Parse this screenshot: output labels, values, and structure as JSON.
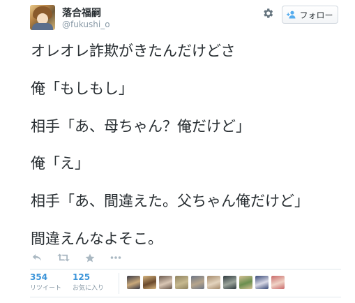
{
  "profile": {
    "display_name": "落合福嗣",
    "screen_name": "@fukushi_o"
  },
  "header": {
    "gear_icon": "gear-icon",
    "follow_label": "フォロー",
    "follow_icon": "follow-person-icon"
  },
  "tweet": {
    "lines": [
      "オレオレ詐欺がきたんだけどさ",
      "俺「もしもし」",
      "相手「あ、母ちゃん？俺だけど」",
      "俺「え」",
      "相手「あ、間違えた。父ちゃん俺だけど」",
      "間違えんなよそこ。"
    ]
  },
  "actions": {
    "reply_icon": "reply-icon",
    "retweet_icon": "retweet-icon",
    "favorite_icon": "star-icon",
    "more_icon": "more-dots-icon"
  },
  "stats": {
    "retweets": {
      "count": "354",
      "label": "リツイート"
    },
    "favorites": {
      "count": "125",
      "label": "お気に入り"
    }
  },
  "favoriters": [
    {
      "name": "favoriter-avatar",
      "color_a": "#3a3a46",
      "color_b": "#c9a87a"
    },
    {
      "name": "favoriter-avatar",
      "color_a": "#d6b57f",
      "color_b": "#6b4a2d"
    },
    {
      "name": "favoriter-avatar",
      "color_a": "#6b5a4e",
      "color_b": "#d9c6b4"
    },
    {
      "name": "favoriter-avatar",
      "color_a": "#8f8360",
      "color_b": "#c7b98f"
    },
    {
      "name": "favoriter-avatar",
      "color_a": "#6e7686",
      "color_b": "#b6a58d"
    },
    {
      "name": "favoriter-avatar",
      "color_a": "#a48a6c",
      "color_b": "#e3d3bd"
    },
    {
      "name": "favoriter-avatar",
      "color_a": "#2f3a3e",
      "color_b": "#9aa39a"
    },
    {
      "name": "favoriter-avatar",
      "color_a": "#d4c094",
      "color_b": "#6a8f4e"
    },
    {
      "name": "favoriter-avatar",
      "color_a": "#394a78",
      "color_b": "#d9d9e6"
    },
    {
      "name": "favoriter-avatar",
      "color_a": "#c96a6a",
      "color_b": "#f0d3c6"
    }
  ],
  "colors": {
    "text": "#292f33",
    "muted": "#8899a6",
    "accent": "#3b94d9",
    "divider": "#e1e8ed"
  }
}
